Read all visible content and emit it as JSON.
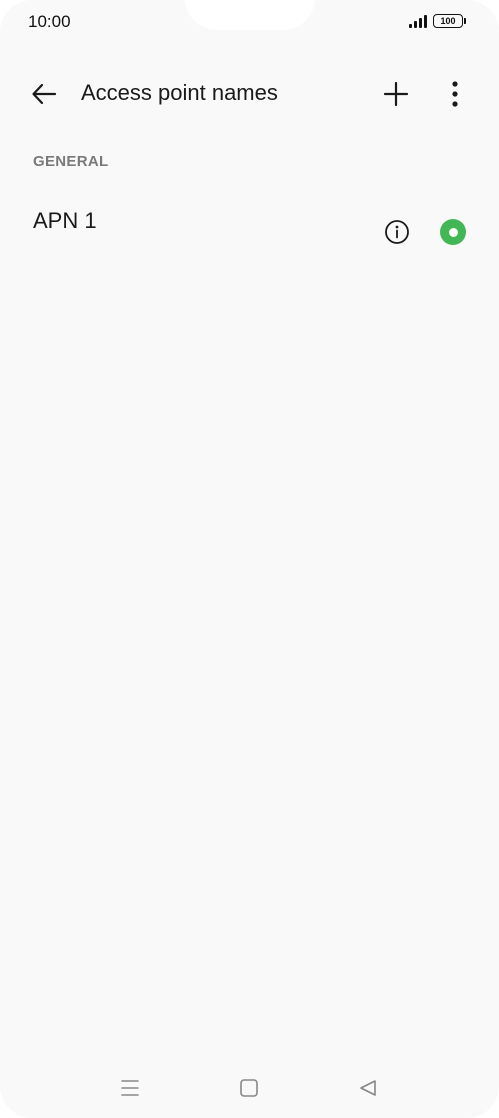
{
  "status_bar": {
    "time": "10:00",
    "battery": "100"
  },
  "toolbar": {
    "title": "Access point names",
    "back_icon": "arrow-left-icon",
    "add_icon": "plus-icon",
    "more_icon": "more-vertical-icon"
  },
  "section": {
    "header": "GENERAL"
  },
  "apn_list": [
    {
      "name": "APN 1",
      "info_icon": "info-icon",
      "selected": true
    }
  ],
  "colors": {
    "background": "#f9f9f9",
    "accent": "#43b755",
    "text_primary": "#1a1a1a",
    "text_secondary": "#7a7a7a"
  },
  "nav_bar": {
    "recents_icon": "menu-lines-icon",
    "home_icon": "square-icon",
    "back_icon": "triangle-back-icon"
  }
}
